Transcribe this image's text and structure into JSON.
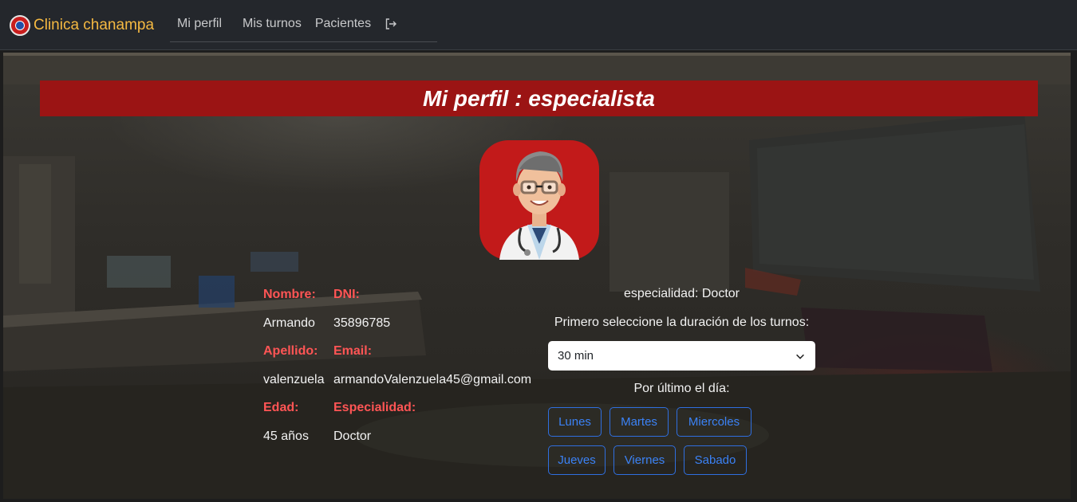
{
  "nav": {
    "brand": "Clinica chanampa",
    "links": [
      "Mi perfil",
      "Mis turnos",
      "Pacientes"
    ],
    "logout_icon": "logout-icon"
  },
  "profile": {
    "title": "Mi perfil : especialista",
    "avatar": "doctor-avatar",
    "labels": {
      "nombre": "Nombre:",
      "dni": "DNI:",
      "apellido": "Apellido:",
      "email": "Email:",
      "edad": "Edad:",
      "especialidad": "Especialidad:"
    },
    "values": {
      "nombre": "Armando",
      "dni": "35896785",
      "apellido": "valenzuela",
      "email": "armandoValenzuela45@gmail.com",
      "edad": "45 años",
      "especialidad": "Doctor"
    }
  },
  "schedule": {
    "speciality_text": "especialidad: Doctor",
    "duration_label": "Primero seleccione la duración de los turnos:",
    "duration_selected": "30 min",
    "day_label": "Por último el día:",
    "days": [
      "Lunes",
      "Martes",
      "Miercoles",
      "Jueves",
      "Viernes",
      "Sabado"
    ]
  },
  "colors": {
    "navbar_bg": "#24272c",
    "brand": "#f5b942",
    "title_bar": "#9b1414",
    "label_red": "#ff5555",
    "day_button": "#3b82f6"
  }
}
